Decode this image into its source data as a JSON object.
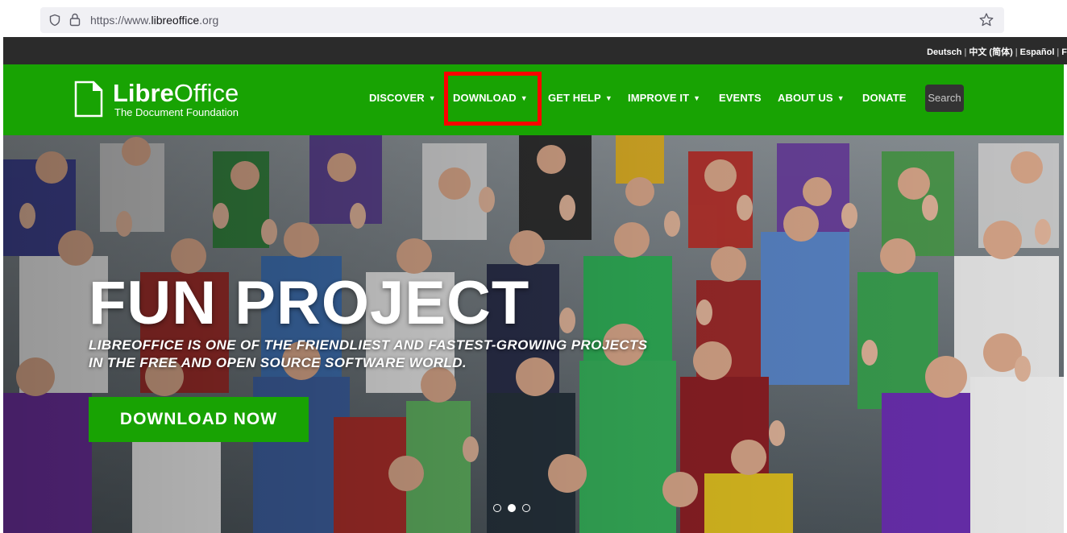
{
  "browser": {
    "url_prefix": "https://www.",
    "url_domain": "libreoffice",
    "url_suffix": ".org",
    "icons": [
      "shield-icon",
      "lock-icon",
      "star-icon"
    ]
  },
  "languages": [
    "Deutsch",
    "中文 (简体)",
    "Español",
    "F"
  ],
  "navbar": {
    "logo_name_bold": "Libre",
    "logo_name_light": "Office",
    "logo_subtitle": "The Document Foundation",
    "items": [
      {
        "label": "DISCOVER",
        "dropdown": true
      },
      {
        "label": "DOWNLOAD",
        "dropdown": true
      },
      {
        "label": "GET HELP",
        "dropdown": true
      },
      {
        "label": "IMPROVE IT",
        "dropdown": true
      },
      {
        "label": "EVENTS",
        "dropdown": false
      },
      {
        "label": "ABOUT US",
        "dropdown": true
      },
      {
        "label": "DONATE",
        "dropdown": false
      }
    ],
    "caret": "▼",
    "search_label": "Search",
    "highlighted_item": "DOWNLOAD"
  },
  "hero": {
    "title": "FUN PROJECT",
    "subtitle_line1": "LIBREOFFICE IS ONE OF THE FRIENDLIEST AND FASTEST-GROWING PROJECTS",
    "subtitle_line2": "IN THE FREE AND OPEN SOURCE SOFTWARE WORLD.",
    "cta_label": "DOWNLOAD NOW",
    "carousel": {
      "count": 3,
      "active_index": 1
    }
  },
  "colors": {
    "brand_green": "#18a303",
    "dark_strip": "#2b2b2b",
    "highlight_red": "#ff0000",
    "search_bg": "#333333"
  }
}
